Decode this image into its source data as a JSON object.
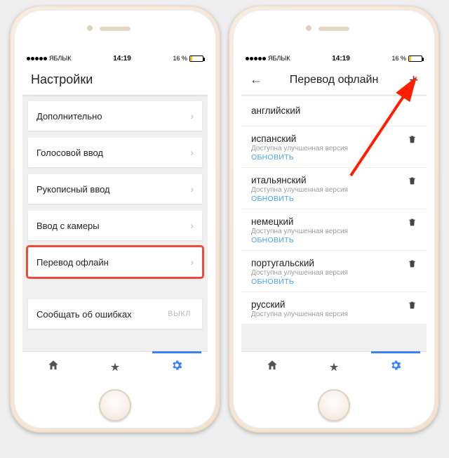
{
  "status": {
    "carrier": "ЯБЛЫК",
    "time": "14:19",
    "battery_pct": "16 %"
  },
  "left": {
    "header_title": "Настройки",
    "rows": [
      {
        "label": "Дополнительно"
      },
      {
        "label": "Голосовой ввод"
      },
      {
        "label": "Рукописный ввод"
      },
      {
        "label": "Ввод с камеры"
      },
      {
        "label": "Перевод офлайн",
        "highlight": true
      },
      {
        "label": "Сообщать об ошибках",
        "toggle": "ВЫКЛ"
      }
    ]
  },
  "right": {
    "header_title": "Перевод офлайн",
    "langs": [
      {
        "name": "английский"
      },
      {
        "name": "испанский",
        "sub": "Доступна улучшенная версия",
        "update": "ОБНОВИТЬ",
        "trash": true
      },
      {
        "name": "итальянский",
        "sub": "Доступна улучшенная версия",
        "update": "ОБНОВИТЬ",
        "trash": true
      },
      {
        "name": "немецкий",
        "sub": "Доступна улучшенная версия",
        "update": "ОБНОВИТЬ",
        "trash": true
      },
      {
        "name": "португальский",
        "sub": "Доступна улучшенная версия",
        "update": "ОБНОВИТЬ",
        "trash": true
      },
      {
        "name": "русский",
        "sub": "Доступна улучшенная версия",
        "trash": true
      }
    ]
  },
  "tabs": {
    "home": "⌂",
    "star": "★",
    "gear": "⚙"
  }
}
